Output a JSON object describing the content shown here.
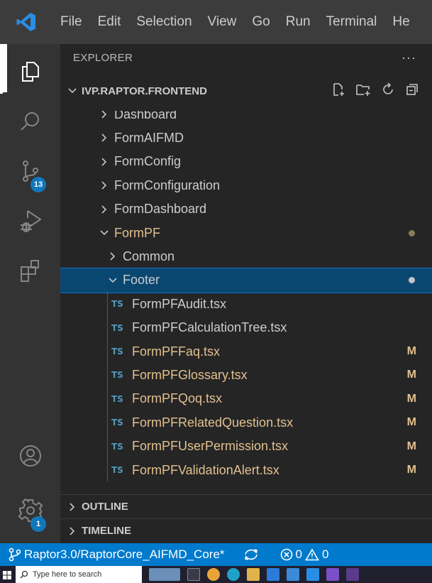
{
  "menubar": {
    "items": [
      "File",
      "Edit",
      "Selection",
      "View",
      "Go",
      "Run",
      "Terminal",
      "He"
    ]
  },
  "activitybar": {
    "items": [
      {
        "name": "explorer-icon",
        "active": true
      },
      {
        "name": "search-icon"
      },
      {
        "name": "source-control-icon",
        "badge": "13"
      },
      {
        "name": "run-debug-icon"
      },
      {
        "name": "extensions-icon"
      }
    ],
    "accounts": {
      "name": "accounts-icon"
    },
    "manage": {
      "name": "gear-icon",
      "badge": "1"
    }
  },
  "sidebar": {
    "title": "EXPLORER",
    "more": "···",
    "project": {
      "title": "IVP.RAPTOR.FRONTEND",
      "actions": [
        "new-file-icon",
        "new-folder-icon",
        "refresh-icon",
        "collapse-all-icon"
      ]
    },
    "tree": [
      {
        "label": "Dashboard",
        "type": "folder",
        "expanded": false,
        "level": 1,
        "partial": true
      },
      {
        "label": "FormAIFMD",
        "type": "folder",
        "expanded": false,
        "level": 1
      },
      {
        "label": "FormConfig",
        "type": "folder",
        "expanded": false,
        "level": 1
      },
      {
        "label": "FormConfiguration",
        "type": "folder",
        "expanded": false,
        "level": 1
      },
      {
        "label": "FormDashboard",
        "type": "folder",
        "expanded": false,
        "level": 1
      },
      {
        "label": "FormPF",
        "type": "folder",
        "expanded": true,
        "level": 1,
        "modified": true,
        "dot": "#8b7d5a"
      },
      {
        "label": "Common",
        "type": "folder",
        "expanded": false,
        "level": 2
      },
      {
        "label": "Footer",
        "type": "folder",
        "expanded": true,
        "level": 2,
        "selected": true,
        "dot": "#c5c5c5"
      },
      {
        "label": "FormPFAudit.tsx",
        "type": "file",
        "icon": "TS",
        "level": 3
      },
      {
        "label": "FormPFCalculationTree.tsx",
        "type": "file",
        "icon": "TS",
        "level": 3
      },
      {
        "label": "FormPFFaq.tsx",
        "type": "file",
        "icon": "TS",
        "level": 3,
        "modified": true,
        "mark": "M"
      },
      {
        "label": "FormPFGlossary.tsx",
        "type": "file",
        "icon": "TS",
        "level": 3,
        "modified": true,
        "mark": "M"
      },
      {
        "label": "FormPFQoq.tsx",
        "type": "file",
        "icon": "TS",
        "level": 3,
        "modified": true,
        "mark": "M"
      },
      {
        "label": "FormPFRelatedQuestion.tsx",
        "type": "file",
        "icon": "TS",
        "level": 3,
        "modified": true,
        "mark": "M"
      },
      {
        "label": "FormPFUserPermission.tsx",
        "type": "file",
        "icon": "TS",
        "level": 3,
        "modified": true,
        "mark": "M"
      },
      {
        "label": "FormPFValidationAlert.tsx",
        "type": "file",
        "icon": "TS",
        "level": 3,
        "modified": true,
        "mark": "M"
      }
    ],
    "outline": "OUTLINE",
    "timeline": "TIMELINE"
  },
  "statusbar": {
    "branch": "Raptor3.0/RaptorCore_AIFMD_Core*",
    "errors": "0",
    "warnings": "0"
  },
  "taskbar": {
    "search_placeholder": "Type here to search"
  }
}
